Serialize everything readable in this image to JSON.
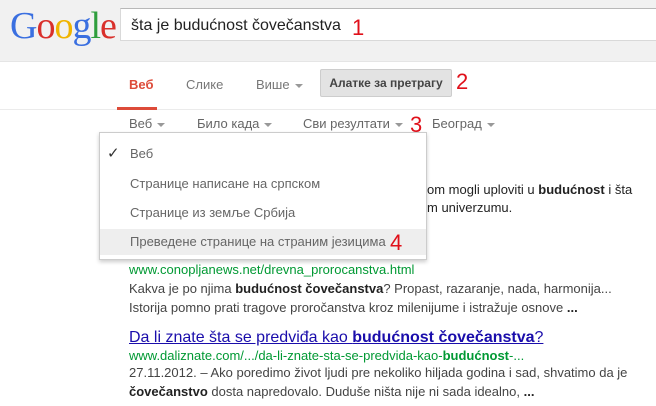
{
  "logo": {
    "letters": [
      "G",
      "o",
      "o",
      "g",
      "l",
      "e"
    ]
  },
  "search": {
    "query": "šta je budućnost čovečanstva"
  },
  "annotations": [
    "1",
    "2",
    "3",
    "4"
  ],
  "tabs": {
    "web": "Веб",
    "images": "Слике",
    "more": "Више",
    "tools": "Алатке за претрагу"
  },
  "filters": {
    "web": "Веб",
    "time": "Било када",
    "results": "Сви резултати",
    "location": "Београд"
  },
  "dropdown": {
    "items": [
      "Веб",
      "Странице написане на српском",
      "Странице из земље Србија",
      "Преведене странице на страним језицима"
    ],
    "checked_index": 0
  },
  "partial_snippet": {
    "line1_pre": "om mogli uploviti u ",
    "line1_bold": "budućnost",
    "line1_post": " i šta",
    "line2": "m univerzumu."
  },
  "results": [
    {
      "url": "www.conopljanews.net/drevna_prorocanstva.html",
      "snippet1_pre": "Kakva je po njima ",
      "snippet1_bold": "budućnost čovečanstva",
      "snippet1_post": "? Propast, razaranje, nada, harmonija...",
      "snippet2_pre": "Istorija pomno prati tragove proročanstva kroz milenijume i istražuje osnove ",
      "snippet2_bold": "..."
    },
    {
      "title_pre": "Da li znate šta se predviđa kao ",
      "title_bold": "budućnost čovečanstva",
      "title_post": "?",
      "url_pre": "www.daliznate.com/.../da-li-znate-sta-se-predvida-kao-",
      "url_bold": "budućnost",
      "url_post": "-...",
      "snippet1": "27.11.2012. – Ako poredimo život ljudi pre nekoliko hiljada godina i sad, shvatimo da je",
      "snippet2_bold1": "čovečanstvo",
      "snippet2_mid": " dosta napredovalo. Duduše ništa nije ni sada idealno, ",
      "snippet2_bold2": "..."
    }
  ]
}
